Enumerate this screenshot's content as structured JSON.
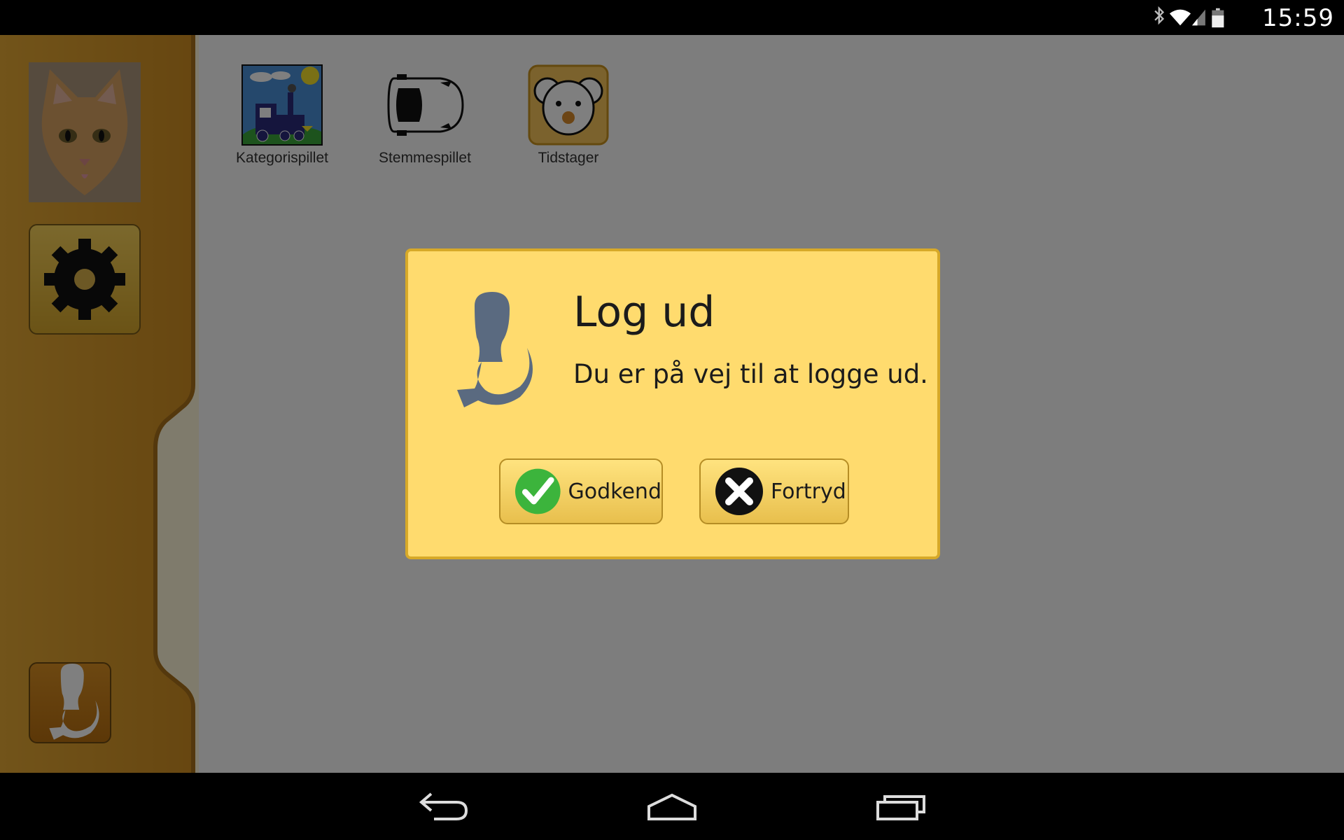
{
  "status_bar": {
    "time": "15:59",
    "icons": [
      "bluetooth-icon",
      "wifi-icon",
      "signal-icon",
      "battery-icon"
    ]
  },
  "apps": [
    {
      "label": "Kategorispillet",
      "icon": "train-picture-icon"
    },
    {
      "label": "Stemmespillet",
      "icon": "car-top-view-icon"
    },
    {
      "label": "Tidstager",
      "icon": "koala-face-icon"
    }
  ],
  "sidebar": {
    "avatar": "cat-photo",
    "settings_icon": "gear-icon",
    "logout_icon": "logout-icon"
  },
  "dialog": {
    "title": "Log ud",
    "message": "Du er på vej til at logge ud.",
    "approve_label": "Godkend",
    "cancel_label": "Fortryd"
  },
  "colors": {
    "accent": "#ffdb6e",
    "sidebar": "#d89a2b",
    "dialog_border": "#d7a928",
    "approve": "#3cb43c"
  },
  "nav_bar": {
    "buttons": [
      "back-icon",
      "home-icon",
      "recent-apps-icon"
    ]
  }
}
